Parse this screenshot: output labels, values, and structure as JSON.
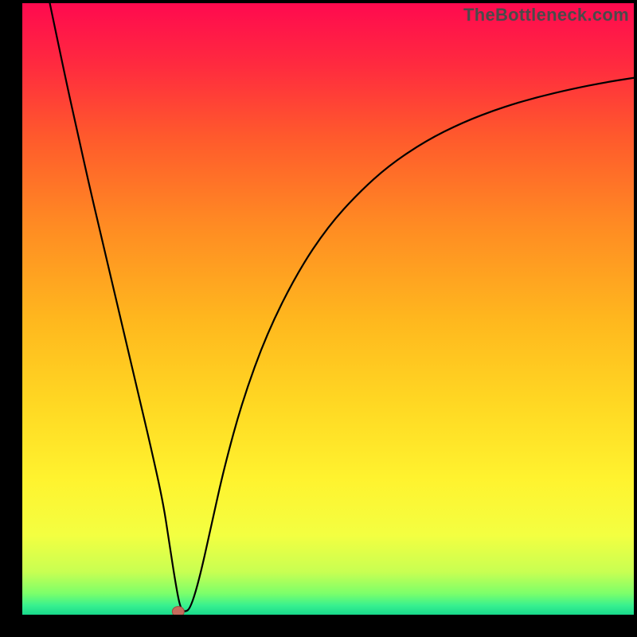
{
  "watermark": "TheBottleneck.com",
  "colors": {
    "frame": "#000000",
    "curve": "#000000",
    "marker_fill": "#c66a5c",
    "marker_stroke": "#9e4b3e",
    "gradient_stops": [
      {
        "offset": 0.0,
        "color": "#ff0a4f"
      },
      {
        "offset": 0.1,
        "color": "#ff2a3f"
      },
      {
        "offset": 0.22,
        "color": "#ff5a2c"
      },
      {
        "offset": 0.36,
        "color": "#ff8a23"
      },
      {
        "offset": 0.52,
        "color": "#ffb81e"
      },
      {
        "offset": 0.66,
        "color": "#ffd923"
      },
      {
        "offset": 0.78,
        "color": "#fff32f"
      },
      {
        "offset": 0.87,
        "color": "#f3ff41"
      },
      {
        "offset": 0.93,
        "color": "#c8ff52"
      },
      {
        "offset": 0.965,
        "color": "#7dff6a"
      },
      {
        "offset": 0.985,
        "color": "#38f08f"
      },
      {
        "offset": 1.0,
        "color": "#18d98c"
      }
    ]
  },
  "chart_data": {
    "type": "line",
    "title": "",
    "xlabel": "",
    "ylabel": "",
    "xlim": [
      0,
      100
    ],
    "ylim": [
      0,
      100
    ],
    "grid": false,
    "legend": false,
    "marker": {
      "x": 25.5,
      "y": 0.5
    },
    "series": [
      {
        "name": "curve",
        "x": [
          4.5,
          7,
          9,
          11,
          13,
          15,
          17,
          19,
          21,
          23,
          24,
          25,
          25.8,
          26.5,
          27.5,
          29,
          31,
          33,
          36,
          40,
          45,
          50,
          55,
          60,
          66,
          72,
          78,
          84,
          90,
          95,
          100
        ],
        "y": [
          100,
          88,
          79,
          70,
          61.5,
          53,
          44.5,
          36,
          27.5,
          18.5,
          12,
          5.5,
          1.2,
          0.4,
          1.0,
          6,
          15,
          24,
          35,
          46,
          56,
          63.5,
          69,
          73.5,
          77.5,
          80.5,
          82.8,
          84.6,
          86,
          87,
          87.8
        ]
      }
    ]
  }
}
